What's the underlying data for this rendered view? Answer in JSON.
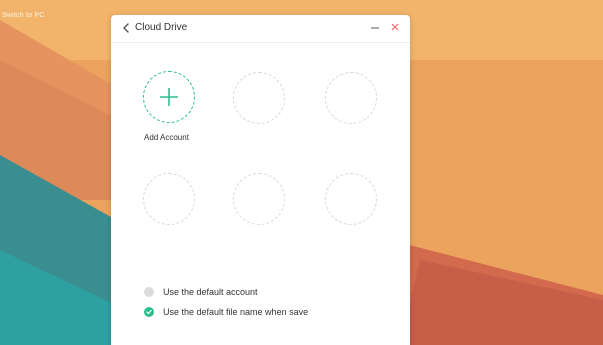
{
  "desktop": {
    "corner_label": "Switch to PC"
  },
  "window": {
    "title": "Cloud Drive",
    "back_icon": "chevron-left-icon",
    "minimize_icon": "minimize-icon",
    "close_icon": "close-icon",
    "add_account_label": "Add Account",
    "options": [
      {
        "label": "Use the default account",
        "checked": false
      },
      {
        "label": "Use the default file name when save",
        "checked": true
      }
    ]
  },
  "colors": {
    "accent": "#2dbe8c",
    "close": "#f26b6b",
    "text": "#333333"
  }
}
